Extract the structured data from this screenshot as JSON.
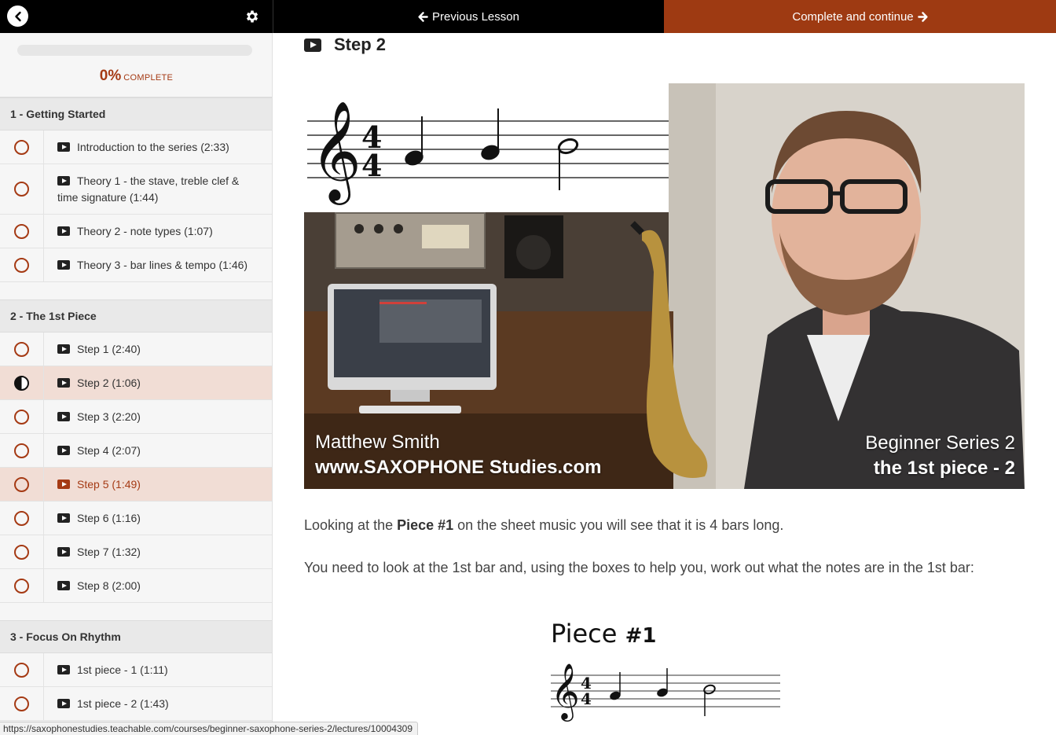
{
  "topbar": {
    "prev_label": "Previous Lesson",
    "complete_label": "Complete and continue"
  },
  "progress": {
    "percent_text": "0%",
    "label": "COMPLETE",
    "fraction": 0.0
  },
  "sections": [
    {
      "title": "1 - Getting Started",
      "lectures": [
        {
          "title": "Introduction to the series (2:33)",
          "status": "none"
        },
        {
          "title": "Theory 1 - the stave, treble clef & time signature (1:44)",
          "status": "none"
        },
        {
          "title": "Theory 2 - note types (1:07)",
          "status": "none"
        },
        {
          "title": "Theory 3 - bar lines & tempo (1:46)",
          "status": "none"
        }
      ]
    },
    {
      "title": "2 - The 1st Piece",
      "lectures": [
        {
          "title": "Step 1 (2:40)",
          "status": "none"
        },
        {
          "title": "Step 2 (1:06)",
          "status": "in-progress"
        },
        {
          "title": "Step 3 (2:20)",
          "status": "none"
        },
        {
          "title": "Step 4 (2:07)",
          "status": "none"
        },
        {
          "title": "Step 5 (1:49)",
          "status": "hover"
        },
        {
          "title": "Step 6 (1:16)",
          "status": "none"
        },
        {
          "title": "Step 7 (1:32)",
          "status": "none"
        },
        {
          "title": "Step 8 (2:00)",
          "status": "none"
        }
      ]
    },
    {
      "title": "3 - Focus On Rhythm",
      "lectures": [
        {
          "title": "1st piece - 1 (1:11)",
          "status": "none"
        },
        {
          "title": "1st piece - 2 (1:43)",
          "status": "none"
        }
      ]
    }
  ],
  "main": {
    "step_title": "Step 2",
    "video": {
      "caption_name": "Matthew Smith",
      "caption_site": "www.SAXOPHONE Studies.com",
      "caption_series": "Beginner Series 2",
      "caption_piece": "the 1st piece - 2"
    },
    "paragraph1_pre": "Looking at the ",
    "paragraph1_bold": "Piece #1",
    "paragraph1_post": " on the sheet music you will see that it is 4 bars long.",
    "paragraph2": "You need to look at the 1st bar and, using the boxes to help you, work out what the notes are in the 1st bar:",
    "piece_title": "Piece",
    "piece_number": "#1"
  },
  "statusbar": {
    "url": "https://saxophonestudies.teachable.com/courses/beginner-saxophone-series-2/lectures/10004309"
  },
  "colors": {
    "accent": "#9e3a12",
    "active_row": "#f1ddd5"
  }
}
